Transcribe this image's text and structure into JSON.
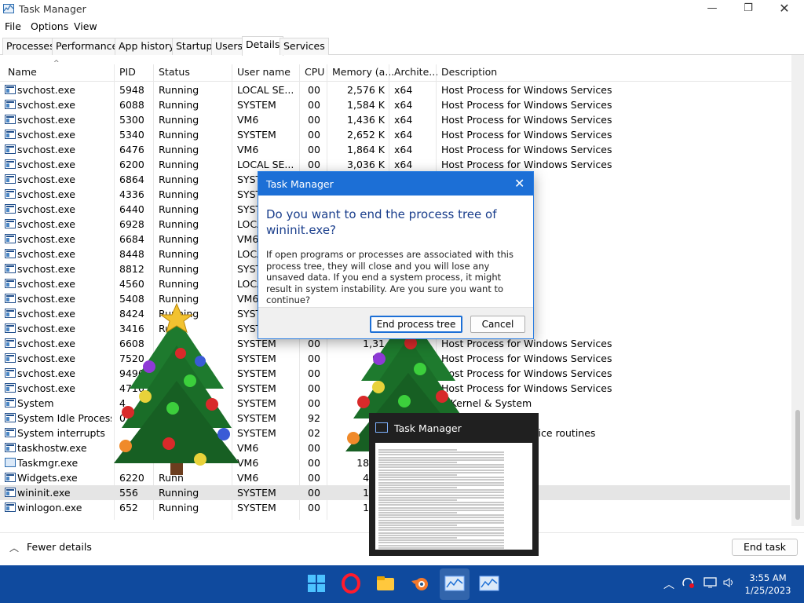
{
  "window": {
    "title": "Task Manager"
  },
  "menu": [
    "File",
    "Options",
    "View"
  ],
  "tabs": [
    "Processes",
    "Performance",
    "App history",
    "Startup",
    "Users",
    "Details",
    "Services"
  ],
  "columns": [
    "Name",
    "PID",
    "Status",
    "User name",
    "CPU",
    "Memory (a...",
    "Archite...",
    "Description"
  ],
  "rows": [
    {
      "name": "svchost.exe",
      "pid": "5948",
      "status": "Running",
      "user": "LOCAL SE...",
      "cpu": "00",
      "mem": "2,576 K",
      "arch": "x64",
      "desc": "Host Process for Windows Services"
    },
    {
      "name": "svchost.exe",
      "pid": "6088",
      "status": "Running",
      "user": "SYSTEM",
      "cpu": "00",
      "mem": "1,584 K",
      "arch": "x64",
      "desc": "Host Process for Windows Services"
    },
    {
      "name": "svchost.exe",
      "pid": "5300",
      "status": "Running",
      "user": "VM6",
      "cpu": "00",
      "mem": "1,436 K",
      "arch": "x64",
      "desc": "Host Process for Windows Services"
    },
    {
      "name": "svchost.exe",
      "pid": "5340",
      "status": "Running",
      "user": "SYSTEM",
      "cpu": "00",
      "mem": "2,652 K",
      "arch": "x64",
      "desc": "Host Process for Windows Services"
    },
    {
      "name": "svchost.exe",
      "pid": "6476",
      "status": "Running",
      "user": "VM6",
      "cpu": "00",
      "mem": "1,864 K",
      "arch": "x64",
      "desc": "Host Process for Windows Services"
    },
    {
      "name": "svchost.exe",
      "pid": "6200",
      "status": "Running",
      "user": "LOCAL SE...",
      "cpu": "00",
      "mem": "3,036 K",
      "arch": "x64",
      "desc": "Host Process for Windows Services"
    },
    {
      "name": "svchost.exe",
      "pid": "6864",
      "status": "Running",
      "user": "SYST",
      "cpu": "",
      "mem": "",
      "arch": "",
      "desc": "ows Services"
    },
    {
      "name": "svchost.exe",
      "pid": "4336",
      "status": "Running",
      "user": "SYST",
      "cpu": "",
      "mem": "",
      "arch": "",
      "desc": "ows Services"
    },
    {
      "name": "svchost.exe",
      "pid": "6440",
      "status": "Running",
      "user": "SYST",
      "cpu": "",
      "mem": "",
      "arch": "",
      "desc": "ows Services"
    },
    {
      "name": "svchost.exe",
      "pid": "6928",
      "status": "Running",
      "user": "LOCA",
      "cpu": "",
      "mem": "",
      "arch": "",
      "desc": "ows Services"
    },
    {
      "name": "svchost.exe",
      "pid": "6684",
      "status": "Running",
      "user": "VM6",
      "cpu": "",
      "mem": "",
      "arch": "",
      "desc": "ows Services"
    },
    {
      "name": "svchost.exe",
      "pid": "8448",
      "status": "Running",
      "user": "LOCA",
      "cpu": "",
      "mem": "",
      "arch": "",
      "desc": "ows Services"
    },
    {
      "name": "svchost.exe",
      "pid": "8812",
      "status": "Running",
      "user": "SYST",
      "cpu": "",
      "mem": "",
      "arch": "",
      "desc": "ows Services"
    },
    {
      "name": "svchost.exe",
      "pid": "4560",
      "status": "Running",
      "user": "LOCA",
      "cpu": "",
      "mem": "",
      "arch": "",
      "desc": "ows Services"
    },
    {
      "name": "svchost.exe",
      "pid": "5408",
      "status": "Running",
      "user": "VM6",
      "cpu": "",
      "mem": "",
      "arch": "",
      "desc": "ows Services"
    },
    {
      "name": "svchost.exe",
      "pid": "8424",
      "status": "Running",
      "user": "SYST",
      "cpu": "",
      "mem": "",
      "arch": "",
      "desc": "ows Services"
    },
    {
      "name": "svchost.exe",
      "pid": "3416",
      "status": "Ru",
      "user": "SYST",
      "cpu": "",
      "mem": "",
      "arch": "",
      "desc": "ows Services"
    },
    {
      "name": "svchost.exe",
      "pid": "6608",
      "status": "",
      "user": "SYSTEM",
      "cpu": "00",
      "mem": "1,31",
      "arch": "",
      "desc": "Host Process for Windows Services"
    },
    {
      "name": "svchost.exe",
      "pid": "7520",
      "status": "",
      "user": "SYSTEM",
      "cpu": "00",
      "mem": "92",
      "arch": "",
      "desc": "Host Process for Windows Services"
    },
    {
      "name": "svchost.exe",
      "pid": "9496",
      "status": "",
      "user": "SYSTEM",
      "cpu": "00",
      "mem": "2,",
      "arch": "",
      "desc": "Host Process for Windows Services"
    },
    {
      "name": "svchost.exe",
      "pid": "4716",
      "status": "",
      "user": "SYSTEM",
      "cpu": "00",
      "mem": "1,",
      "arch": "",
      "desc": "Host Process for Windows Services"
    },
    {
      "name": "System",
      "pid": "4",
      "status": "",
      "user": "SYSTEM",
      "cpu": "00",
      "mem": "",
      "arch": "",
      "desc": "T Kernel & System"
    },
    {
      "name": "System Idle Process",
      "pid": "0",
      "status": "",
      "user": "SYSTEM",
      "cpu": "92",
      "mem": "",
      "arch": "",
      "desc": "processor is idle"
    },
    {
      "name": "System interrupts",
      "pid": "",
      "status": "",
      "user": "SYSTEM",
      "cpu": "02",
      "mem": "",
      "arch": "",
      "desc": "s and interrupt service routines"
    },
    {
      "name": "taskhostw.exe",
      "pid": "",
      "status": "",
      "user": "VM6",
      "cpu": "00",
      "mem": "",
      "arch": "",
      "desc": "ows Tasks"
    },
    {
      "name": "Taskmgr.exe",
      "pid": "",
      "status": "",
      "user": "VM6",
      "cpu": "00",
      "mem": "18,38",
      "arch": "",
      "desc": ""
    },
    {
      "name": "Widgets.exe",
      "pid": "6220",
      "status": "Runn",
      "user": "VM6",
      "cpu": "00",
      "mem": "4,33",
      "arch": "",
      "desc": ""
    },
    {
      "name": "wininit.exe",
      "pid": "556",
      "status": "Running",
      "user": "SYSTEM",
      "cpu": "00",
      "mem": "1,14",
      "arch": "",
      "desc": "ication"
    },
    {
      "name": "winlogon.exe",
      "pid": "652",
      "status": "Running",
      "user": "SYSTEM",
      "cpu": "00",
      "mem": "1,60",
      "arch": "",
      "desc": "ation"
    }
  ],
  "footer": {
    "fewer_details": "Fewer details",
    "end_task": "End task"
  },
  "dialog": {
    "title": "Task Manager",
    "heading": "Do you want to end the process tree of wininit.exe?",
    "body": "If open programs or processes are associated with this process tree, they will close and you will lose any unsaved data. If you end a system process, it might result in system instability. Are you sure you want to continue?",
    "confirm": "End process tree",
    "cancel": "Cancel"
  },
  "thumbnail": {
    "title": "Task Manager"
  },
  "clock": {
    "time": "3:55 AM",
    "date": "1/25/2023"
  },
  "colors": {
    "taskbar": "#0f4a9e",
    "dialog_title": "#1c6fd6",
    "heading": "#1a3e8c"
  }
}
